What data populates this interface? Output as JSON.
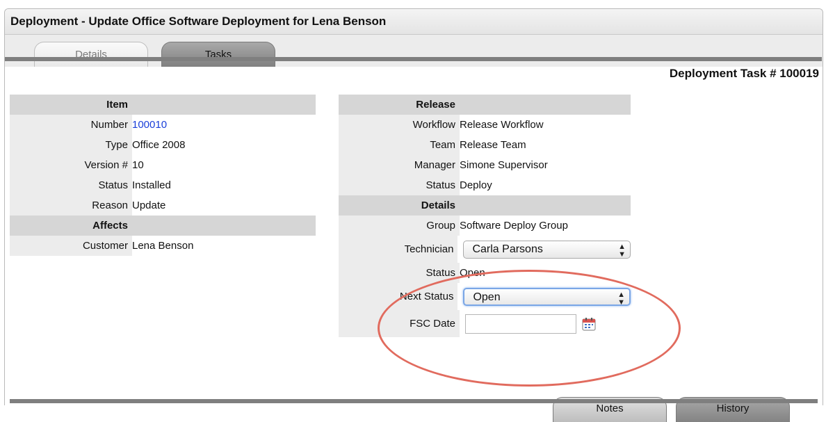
{
  "window": {
    "title": "Deployment - Update Office Software Deployment for Lena Benson"
  },
  "tabs": [
    {
      "label": "Details"
    },
    {
      "label": "Tasks"
    }
  ],
  "task_number": "Deployment Task # 100019",
  "item_section": {
    "header": "Item",
    "fields": [
      {
        "label": "Number",
        "value": "100010"
      },
      {
        "label": "Type",
        "value": "Office 2008"
      },
      {
        "label": "Version #",
        "value": "10"
      },
      {
        "label": "Status",
        "value": "Installed"
      },
      {
        "label": "Reason",
        "value": "Update"
      }
    ],
    "affects_header": "Affects",
    "affects_fields": [
      {
        "label": "Customer",
        "value": "Lena Benson"
      }
    ]
  },
  "release_section": {
    "header": "Release",
    "fields": [
      {
        "label": "Workflow",
        "value": "Release Workflow"
      },
      {
        "label": "Team",
        "value": "Release Team"
      },
      {
        "label": "Manager",
        "value": "Simone Supervisor"
      },
      {
        "label": "Status",
        "value": "Deploy"
      }
    ],
    "details_header": "Details",
    "group": {
      "label": "Group",
      "value": "Software Deploy Group"
    },
    "technician": {
      "label": "Technician",
      "value": "Carla Parsons"
    },
    "status": {
      "label": "Status",
      "value": "Open"
    },
    "next_status": {
      "label": "Next Status",
      "value": "Open"
    },
    "fsc_date": {
      "label": "FSC Date",
      "value": ""
    }
  },
  "bottom_tabs": [
    {
      "label": "Notes"
    },
    {
      "label": "History"
    }
  ],
  "colors": {
    "highlight": "#e16b5e",
    "link": "#1a3fd9",
    "header_bg": "#d6d6d6",
    "label_bg": "#ececec"
  },
  "icons": {
    "calendar": "calendar-icon",
    "select_arrows": "updown-arrows-icon"
  }
}
